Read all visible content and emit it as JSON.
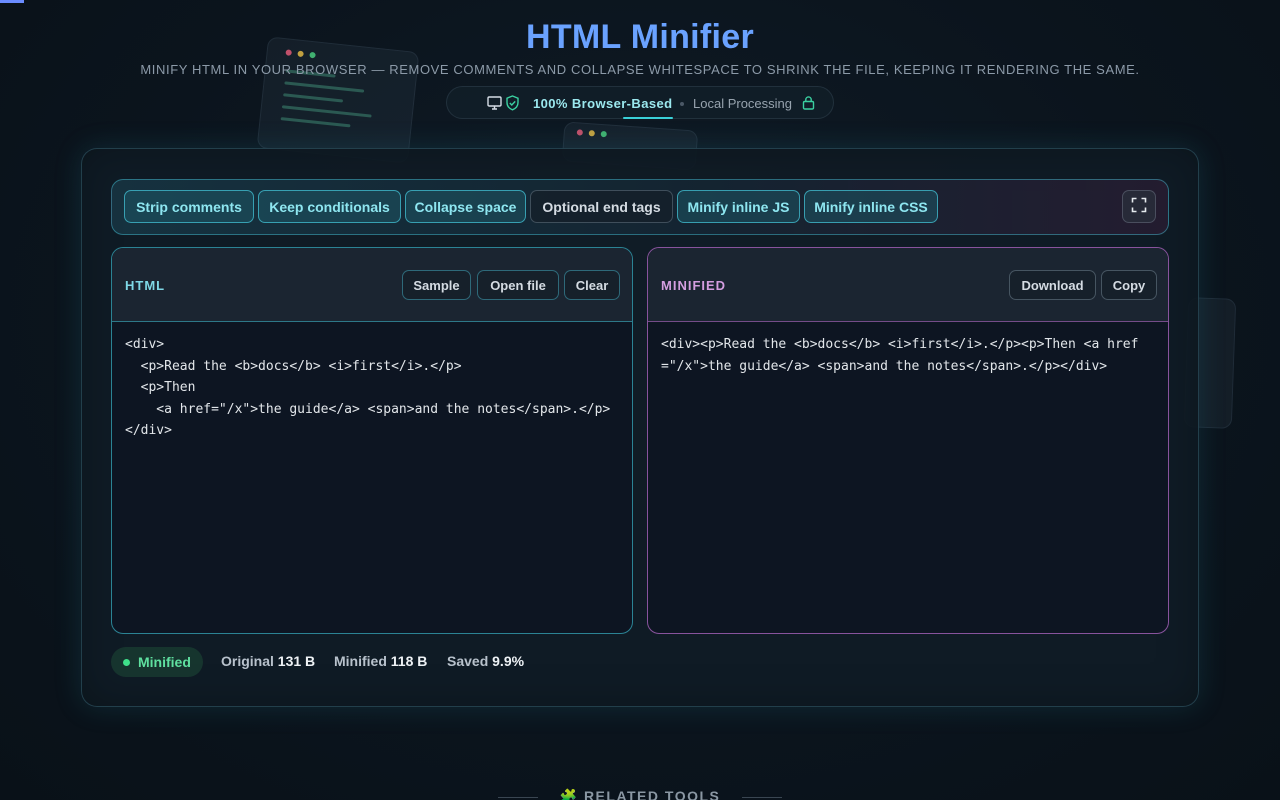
{
  "header": {
    "title": "HTML Minifier",
    "subtitle": "MINIFY HTML IN YOUR BROWSER — REMOVE COMMENTS AND COLLAPSE WHITESPACE TO SHRINK THE FILE, KEEPING IT RENDERING THE SAME.",
    "badge_primary": "100% Browser-Based",
    "badge_secondary": "Local Processing"
  },
  "options": [
    {
      "label": "Strip comments",
      "active": true
    },
    {
      "label": "Keep conditionals",
      "active": true
    },
    {
      "label": "Collapse space",
      "active": true
    },
    {
      "label": "Optional end tags",
      "active": false
    },
    {
      "label": "Minify inline JS",
      "active": true
    },
    {
      "label": "Minify inline CSS",
      "active": true
    }
  ],
  "input_editor": {
    "label": "HTML",
    "sample_label": "Sample",
    "open_label": "Open file",
    "clear_label": "Clear",
    "content": "<div>\n  <p>Read the <b>docs</b> <i>first</i>.</p>\n  <p>Then\n    <a href=\"/x\">the guide</a> <span>and the notes</span>.</p>\n</div>"
  },
  "output_editor": {
    "label": "MINIFIED",
    "download_label": "Download",
    "copy_label": "Copy",
    "content": "<div><p>Read the <b>docs</b> <i>first</i>.</p><p>Then <a href=\"/x\">the guide</a> <span>and the notes</span>.</p></div>"
  },
  "status": {
    "state": "Minified",
    "original_label": "Original",
    "original_value": "131 B",
    "minified_label": "Minified",
    "minified_value": "118 B",
    "saved_label": "Saved",
    "saved_value": "9.9%"
  },
  "related": {
    "icon": "puzzle-icon",
    "label": "RELATED TOOLS"
  },
  "colors": {
    "title": "#6aa2ff",
    "accent_cyan": "#3ad0d8",
    "accent_purple": "#c06fd6",
    "success": "#3fe08a"
  }
}
